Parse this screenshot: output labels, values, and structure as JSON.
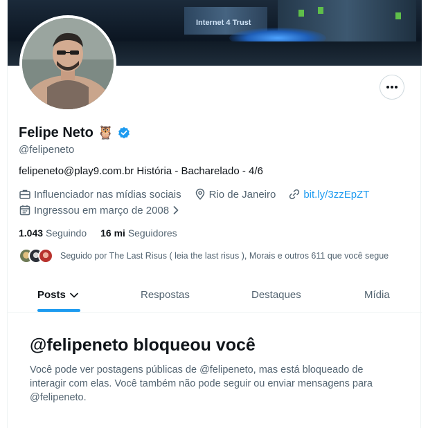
{
  "banner": {
    "logo_text": "Internet 4 Trust"
  },
  "profile": {
    "name": "Felipe Neto",
    "emoji": "🦉",
    "handle": "@felipeneto",
    "bio": "felipeneto@play9.com.br História - Bacharelado - 4/6",
    "category": "Influenciador nas mídias sociais",
    "location": "Rio de Janeiro",
    "website": "bit.ly/3zzEpZT",
    "joined": "Ingressou em março de 2008",
    "following_count": "1.043",
    "following_label": "Seguindo",
    "followers_count": "16 mi",
    "followers_label": "Seguidores",
    "followed_by": "Seguido por The Last Risus ( leia the last risus ), Morais e outros 611 que você segue"
  },
  "actions": {
    "more_label": "•••"
  },
  "tabs": [
    {
      "label": "Posts"
    },
    {
      "label": "Respostas"
    },
    {
      "label": "Destaques"
    },
    {
      "label": "Mídia"
    }
  ],
  "blocked": {
    "title": "@felipeneto bloqueou você",
    "message": "Você pode ver postagens públicas de @felipeneto, mas está bloqueado de interagir com elas. Você também não pode seguir ou enviar mensagens para @felipeneto."
  },
  "colors": {
    "accent": "#1d9bf0",
    "text": "#0f1419",
    "secondary": "#536471"
  },
  "icons": [
    "briefcase-icon",
    "location-pin-icon",
    "link-icon",
    "calendar-icon",
    "chevron-right-icon",
    "chevron-down-icon",
    "verified-badge-icon",
    "more-options-icon"
  ]
}
